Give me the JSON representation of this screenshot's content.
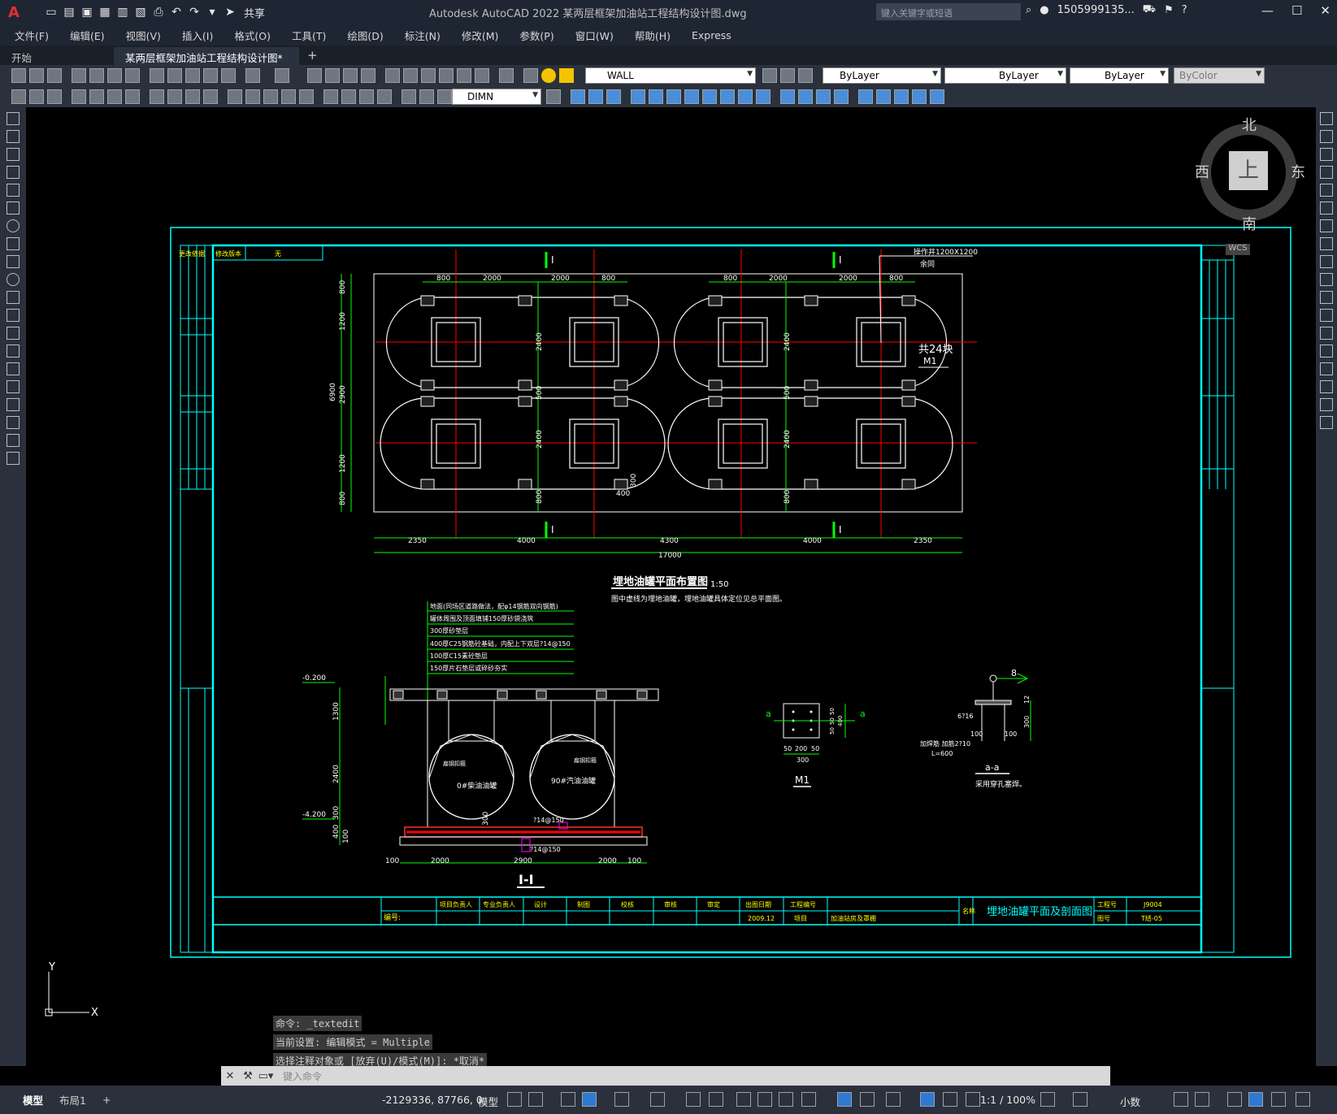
{
  "app": {
    "title": "Autodesk AutoCAD 2022    某两层框架加油站工程结构设计图.dwg",
    "logo": "A",
    "share_label": "共享",
    "search_placeholder": "键入关键字或短语",
    "user": "1505999135...",
    "win_controls": [
      "—",
      "☐",
      "✕"
    ]
  },
  "menu": [
    "文件(F)",
    "编辑(E)",
    "视图(V)",
    "插入(I)",
    "格式(O)",
    "工具(T)",
    "绘图(D)",
    "标注(N)",
    "修改(M)",
    "参数(P)",
    "窗口(W)",
    "帮助(H)",
    "Express"
  ],
  "tabs": [
    {
      "label": "开始"
    },
    {
      "label": "某两层框架加油站工程结构设计图*"
    }
  ],
  "tab_close": "✕",
  "tab_add": "+",
  "toolbar": {
    "layer": "WALL",
    "color": "ByLayer",
    "linetype": "ByLayer",
    "lineweight": "ByLayer",
    "plotstyle": "ByColor",
    "dimstyle": "DIMN"
  },
  "viewcube": {
    "north": "北",
    "south": "南",
    "east": "东",
    "west": "西",
    "top": "上",
    "wcs": "WCS"
  },
  "drawing": {
    "plan_title": "埋地油罐平面布置图",
    "plan_scale": "1:50",
    "plan_note": "图中虚线为埋地油罐，埋地油罐具体定位见总平面图。",
    "section_label": "I",
    "section_title": "I-I",
    "manhole_note": "操作井1200X1200",
    "manhole_note2": "余同",
    "count_note": "共24块",
    "m1_label": "M1",
    "dims_top_left": [
      "800",
      "2000",
      "2000",
      "800"
    ],
    "dims_top_right": [
      "800",
      "2000",
      "2000",
      "800"
    ],
    "dims_left": [
      "800",
      "1200",
      "2900",
      "1200",
      "800"
    ],
    "dims_total_left": "6900",
    "dims_mid": [
      "2400",
      "500",
      "2400",
      "800"
    ],
    "dims_bottom": [
      "2350",
      "4000",
      "4300",
      "4000",
      "2350"
    ],
    "dims_total": "17000",
    "dim_400": "400",
    "dim_300": "300",
    "layers_notes": [
      "地面(同场区道路做法，配φ14钢筋双向钢筋)",
      "罐体周围及顶面填铺150厚砂袋浇筑",
      "300厚砂垫层",
      "400厚C25钢筋砼基础，内配上下双层?14@150",
      "100厚C15素砼垫层",
      "150厚片石垫层或碎砂夯实"
    ],
    "elev_top": "-0.200",
    "elev_bottom": "-4.200",
    "sec_dims_left": [
      "1300",
      "2400",
      "300",
      "400",
      "100"
    ],
    "sec_dims_bottom": [
      "100",
      "2000",
      "2900",
      "2000",
      "100"
    ],
    "tank1": "0#柴油油罐",
    "tank2": "90#汽油油罐",
    "tank_strap": "扁钢扣箍",
    "rebar1": "?14@150",
    "rebar2": "?14@150",
    "m1_dims": [
      "50",
      "200",
      "50",
      "300"
    ],
    "m1_side": [
      "50",
      "50",
      "50",
      "400"
    ],
    "a_mark": "a",
    "aa_title": "a-a",
    "aa_note": "采用穿孔塞焊。",
    "aa_6716": "6?16",
    "aa_rebar": "加焊筋 加筋2?10",
    "aa_len": "L=600",
    "aa_100a": "100",
    "aa_100b": "100",
    "aa_300": "300",
    "aa_12": "12",
    "aa_8": "8",
    "tb_rev": [
      "更改依据",
      "修改版本",
      "无"
    ],
    "tb_roles": [
      "项目负责人",
      "专业负责人",
      "设计",
      "制图",
      "校核",
      "审核",
      "审定",
      "出图日期",
      "工程编号"
    ],
    "tb_date": "2009.12",
    "tb_item": "项目",
    "tb_item_val": "加油站房及罩棚",
    "tb_no": "编号:",
    "tb_name_lbl": "名称",
    "tb_name": "埋地油罐平面及剖面图",
    "tb_job_lbl": "工程号",
    "tb_job": "J9004",
    "tb_dwg_lbl": "图号",
    "tb_dwg": "T结-05"
  },
  "command": {
    "history": [
      "命令: _textedit",
      "当前设置: 编辑模式 = Multiple",
      "选择注释对象或 [放弃(U)/模式(M)]: *取消*"
    ],
    "placeholder": "键入命令"
  },
  "status": {
    "model_tab": "模型",
    "layout_tab": "布局1",
    "add_tab": "+",
    "coords": "-2129336, 87766, 0",
    "mode": "模型",
    "scale": "1:1 / 100%",
    "units": "小数"
  },
  "ucs": {
    "x": "X",
    "y": "Y"
  }
}
